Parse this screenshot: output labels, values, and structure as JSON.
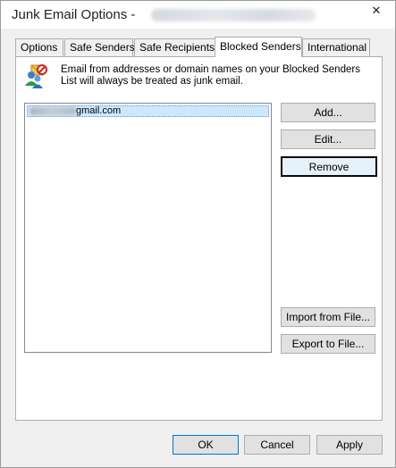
{
  "window": {
    "title": "Junk Email Options - ",
    "close_glyph": "✕"
  },
  "tabs": [
    {
      "label": "Options",
      "active": false
    },
    {
      "label": "Safe Senders",
      "active": false
    },
    {
      "label": "Safe Recipients",
      "active": false
    },
    {
      "label": "Blocked Senders",
      "active": true
    },
    {
      "label": "International",
      "active": false
    }
  ],
  "panel": {
    "icon": "blocked-senders-icon",
    "description": "Email from addresses or domain names on your Blocked Senders List will always be treated as junk email.",
    "list_items": [
      {
        "text": "gmail.com",
        "selected": true
      }
    ],
    "buttons": {
      "add": "Add...",
      "edit": "Edit...",
      "remove": "Remove",
      "import": "Import from File...",
      "export": "Export to File..."
    }
  },
  "footer": {
    "ok": "OK",
    "cancel": "Cancel",
    "apply": "Apply"
  },
  "colors": {
    "selection": "#cce8ff",
    "default_button_border": "#0078d7"
  }
}
